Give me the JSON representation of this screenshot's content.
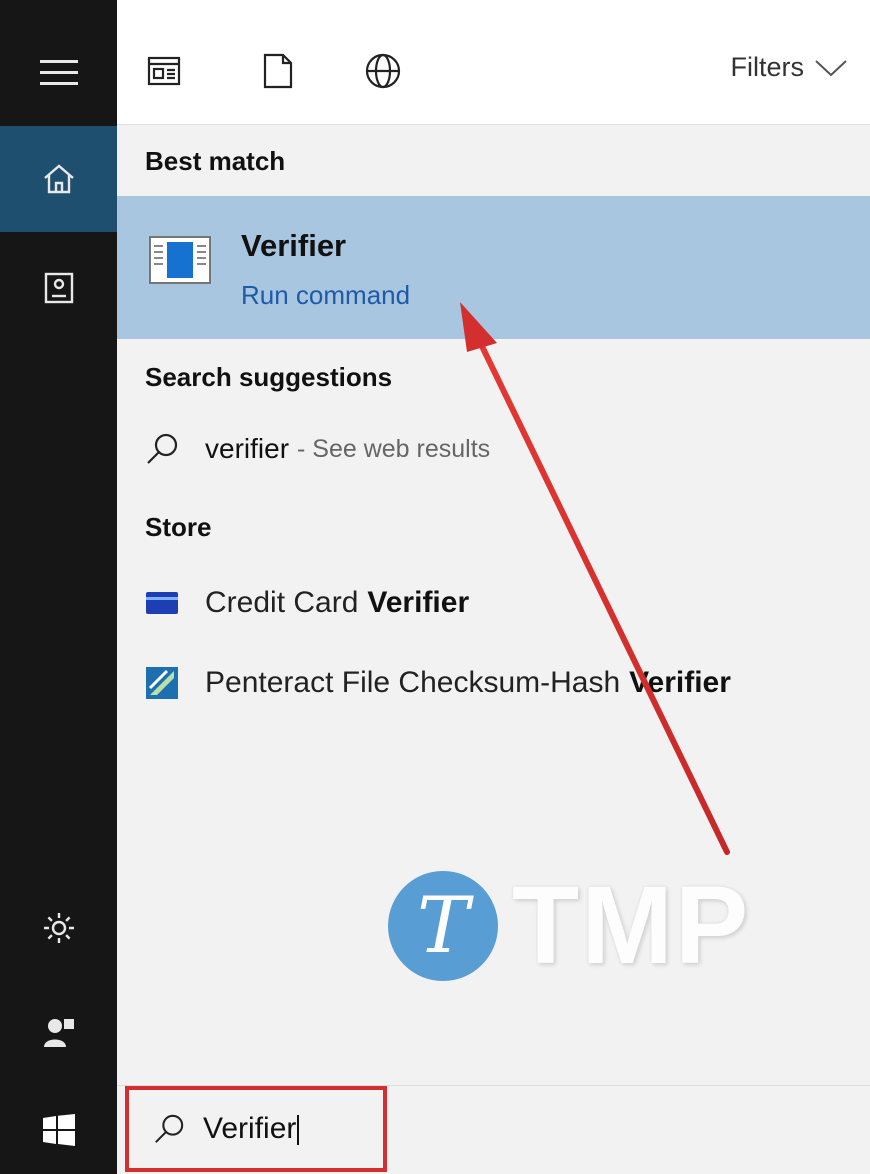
{
  "toolbar": {
    "filters_label": "Filters"
  },
  "sections": {
    "best_match": "Best match",
    "search_suggestions": "Search suggestions",
    "store": "Store"
  },
  "best_match": {
    "title": "Verifier",
    "subtitle": "Run command"
  },
  "suggestion": {
    "query": "verifier",
    "suffix": "- See web results"
  },
  "store_items": [
    {
      "prefix": "Credit Card",
      "bold": "Verifier"
    },
    {
      "prefix": "Penteract File Checksum-Hash",
      "bold": "Verifier"
    }
  ],
  "search": {
    "value": "Verifier"
  },
  "watermark": {
    "monogram": "T",
    "text": "TMP"
  },
  "colors": {
    "rail": "#161616",
    "rail_active": "#1f4f6e",
    "highlight": "#a9c6e0",
    "link": "#1f5aa8",
    "annotation": "#d32f2f"
  },
  "icons": {
    "rail": [
      "hamburger-icon",
      "home-icon",
      "documents-icon",
      "settings-icon",
      "user-icon",
      "windows-start-icon"
    ],
    "topbar": [
      "apps-icon",
      "document-icon",
      "globe-icon",
      "chevron-down-icon"
    ]
  }
}
